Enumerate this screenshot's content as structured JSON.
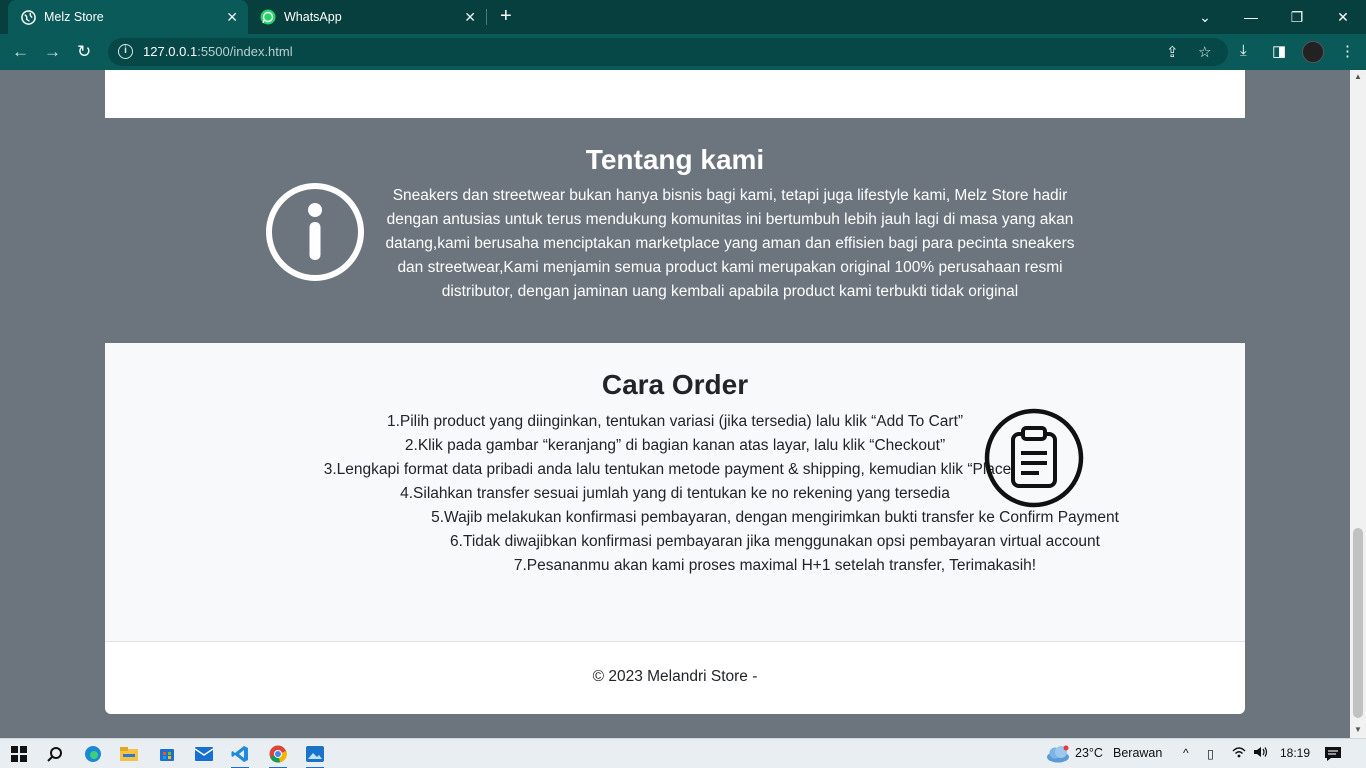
{
  "browser": {
    "tabs": [
      {
        "title": "Melz Store",
        "active": true
      },
      {
        "title": "WhatsApp",
        "active": false
      }
    ],
    "url_host": "127.0.0.1",
    "url_rest": ":5500/index.html"
  },
  "about": {
    "title": "Tentang kami",
    "text": "Sneakers dan streetwear bukan hanya bisnis bagi kami, tetapi juga lifestyle kami, Melz Store hadir dengan antusias untuk terus mendukung komunitas ini bertumbuh lebih jauh lagi di masa yang akan datang,kami berusaha menciptakan marketplace yang aman dan effisien bagi para pecinta sneakers dan streetwear,Kami menjamin semua product kami merupakan original 100% perusahaan resmi distributor, dengan jaminan uang kembali apabila product kami terbukti tidak original"
  },
  "order": {
    "title": "Cara Order",
    "steps": [
      "1.Pilih product yang diinginkan, tentukan variasi (jika tersedia) lalu klik “Add To Cart”",
      "2.Klik pada gambar “keranjang” di bagian kanan atas layar, lalu klik “Checkout”",
      "3.Lengkapi format data pribadi anda lalu tentukan metode payment & shipping, kemudian klik “Place",
      "4.Silahkan transfer sesuai jumlah yang di tentukan ke no rekening yang tersedia",
      "5.Wajib melakukan konfirmasi pembayaran, dengan mengirimkan bukti transfer ke Confirm Payment",
      "6.Tidak diwajibkan konfirmasi pembayaran jika menggunakan opsi pembayaran virtual account",
      "7.Pesananmu akan kami proses maximal H+1 setelah transfer, Terimakasih!"
    ]
  },
  "footer": {
    "text": "© 2023 Melandri Store -"
  },
  "taskbar": {
    "weather": "23°C",
    "weather_desc": "Berawan",
    "time": "18:19"
  }
}
